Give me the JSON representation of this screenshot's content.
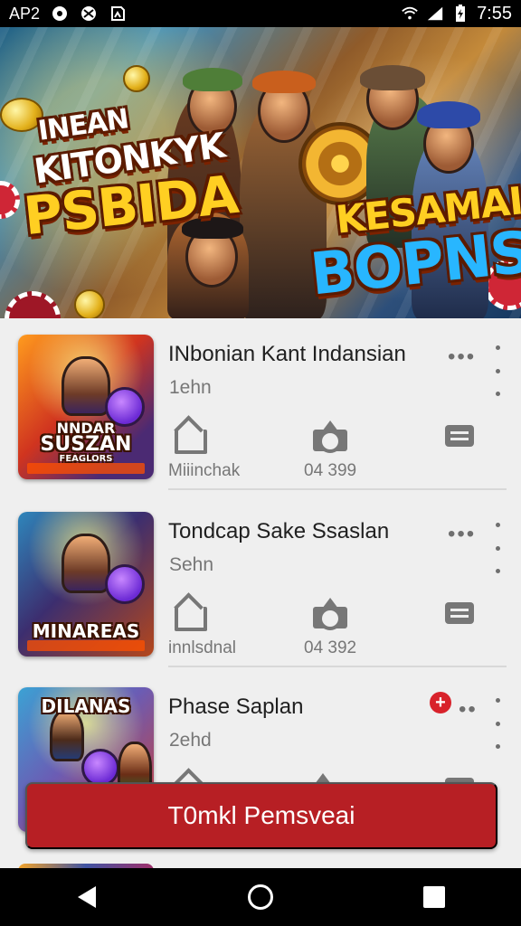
{
  "status_bar": {
    "carrier": "AP2",
    "time": "7:55",
    "left_icons": [
      "record-icon",
      "shuffle-icon",
      "screenshot-icon"
    ],
    "right_icons": [
      "wifi-icon",
      "signal-icon",
      "battery-charging-icon"
    ]
  },
  "banner": {
    "lines": [
      "INEAN",
      "KITONKYK",
      "PSBIDA",
      "KESAMAI",
      "BOPNS"
    ]
  },
  "items": [
    {
      "title": "INbonian Kant Indansian",
      "subtitle": "1ehn",
      "thumbnail_text": [
        "NNDAR",
        "SUSZAN",
        "FEAGLORS"
      ],
      "actions": [
        {
          "icon": "home-icon",
          "label": "Miiinchak"
        },
        {
          "icon": "camera-icon",
          "label": "04 399"
        },
        {
          "icon": "chat-icon",
          "label": ""
        }
      ]
    },
    {
      "title": "Tondcap Sake Ssaslan",
      "subtitle": "Sehn",
      "thumbnail_text": [
        "MINAREAS"
      ],
      "actions": [
        {
          "icon": "home-icon",
          "label": "innlsdnal"
        },
        {
          "icon": "camera-icon",
          "label": "04 392"
        },
        {
          "icon": "chat-icon",
          "label": ""
        }
      ]
    },
    {
      "title": "Phase Saplan",
      "subtitle": "2ehd",
      "thumbnail_text": [
        "DILANAS"
      ],
      "actions": [
        {
          "icon": "home-icon",
          "label": ""
        },
        {
          "icon": "camera-icon",
          "label": ""
        },
        {
          "icon": "chat-icon",
          "label": ""
        }
      ]
    }
  ],
  "cta_label": "T0mkl Pemsveai",
  "colors": {
    "cta": "#b71f24",
    "text_primary": "#202020",
    "text_secondary": "#777777",
    "alert": "#d8222b"
  },
  "navigation": [
    "back-icon",
    "home-icon",
    "recents-icon"
  ]
}
